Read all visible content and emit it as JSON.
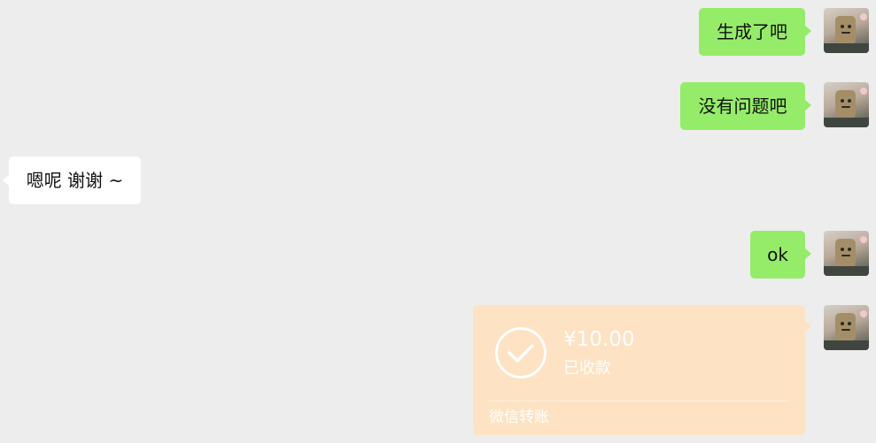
{
  "chat": {
    "messages": [
      {
        "side": "right",
        "text": "生成了吧"
      },
      {
        "side": "right",
        "text": "没有问题吧"
      },
      {
        "side": "left",
        "text": "嗯呢 谢谢 ~"
      },
      {
        "side": "right",
        "text": "ok"
      }
    ],
    "transfer": {
      "amount": "¥10.00",
      "status": "已收款",
      "footer": "微信转账"
    }
  },
  "colors": {
    "background": "#ededed",
    "my_bubble": "#95ec69",
    "their_bubble": "#ffffff",
    "transfer_card": "#fde2c3"
  },
  "icons": {
    "transfer_status": "check-circle-icon",
    "avatar": "user-avatar"
  }
}
